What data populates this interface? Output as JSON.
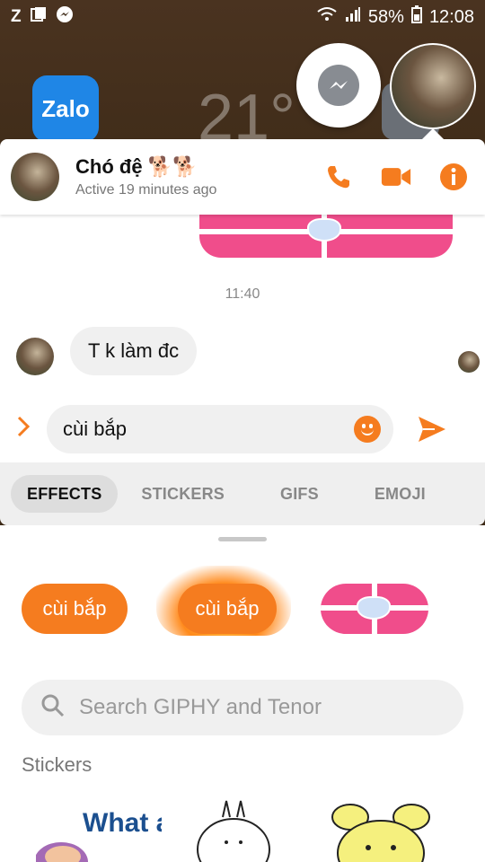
{
  "status_bar": {
    "left_icons": [
      "Z",
      "news-icon",
      "messenger-icon"
    ],
    "battery": "58%",
    "time": "12:08"
  },
  "home_screen": {
    "app_label": "Zalo",
    "clock_partial": "21°"
  },
  "header": {
    "name": "Chó đệ 🐕🐕",
    "status": "Active 19 minutes ago",
    "actions": [
      "phone-icon",
      "video-icon",
      "info-icon"
    ]
  },
  "conversation": {
    "timestamp": "11:40",
    "incoming_message": "T k làm đc"
  },
  "composer": {
    "value": "cùi bắp"
  },
  "tabs": [
    "EFFECTS",
    "STICKERS",
    "GIFS",
    "EMOJI"
  ],
  "active_tab": "EFFECTS",
  "effects": [
    {
      "label": "cùi bắp",
      "style": "plain"
    },
    {
      "label": "cùi bắp",
      "style": "fire"
    },
    {
      "label": "",
      "style": "gift"
    }
  ],
  "search": {
    "placeholder": "Search GIPHY and Tenor"
  },
  "stickers_section": {
    "label": "Stickers",
    "sticker_1_text": "What a"
  },
  "colors": {
    "accent": "#f57c1f",
    "gift_pink": "#f04d8b"
  }
}
